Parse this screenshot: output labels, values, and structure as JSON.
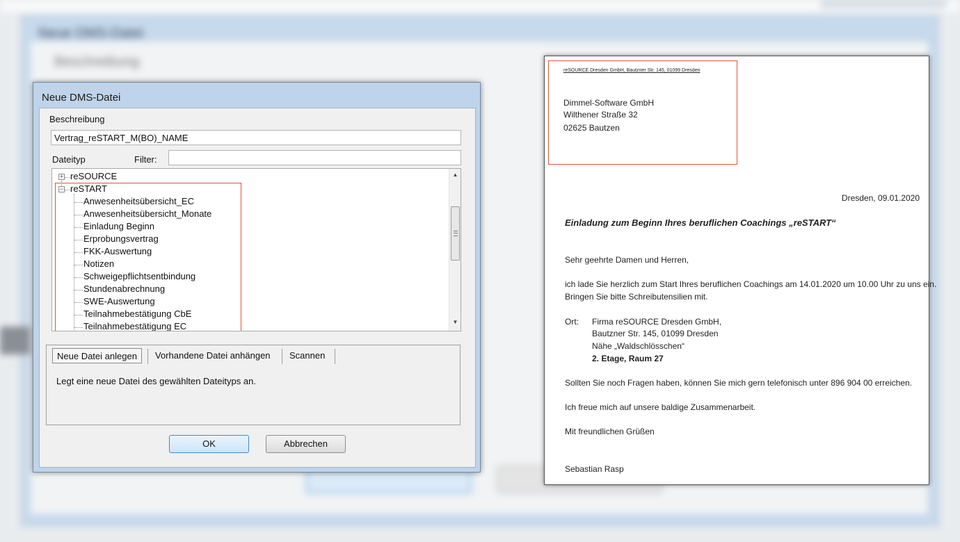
{
  "dialog": {
    "title": "Neue DMS-Datei",
    "beschreibung_label": "Beschreibung",
    "beschreibung_value": "Vertrag_reSTART_M(BO)_NAME",
    "dateityp_label": "Dateityp",
    "filter_label": "Filter:",
    "filter_value": "",
    "tree": {
      "root1": "reSOURCE",
      "root2": "reSTART",
      "children": [
        "Anwesenheitsübersicht_EC",
        "Anwesenheitsübersicht_Monate",
        "Einladung Beginn",
        "Erprobungsvertrag",
        "FKK-Auswertung",
        "Notizen",
        "Schweigepflichtsentbindung",
        "Stundenabrechnung",
        "SWE-Auswertung",
        "Teilnahmebestätigung CbE",
        "Teilnahmebestätigung EC"
      ]
    },
    "tabs": [
      "Neue Datei anlegen",
      "Vorhandene Datei anhängen",
      "Scannen"
    ],
    "tab_description": "Legt eine neue Datei des gewählten Dateityps an.",
    "ok_label": "OK",
    "cancel_label": "Abbrechen"
  },
  "letter": {
    "sender_line": "reSOURCE Dresden GmbH, Bautzner Str. 145, 01099 Dresden",
    "recipient": [
      "Dimmel-Software GmbH",
      "Wilthener Straße 32",
      "02625 Bautzen"
    ],
    "date_line": "Dresden, 09.01.2020",
    "subject": "Einladung zum Beginn Ihres beruflichen Coachings „reSTART“",
    "salutation": "Sehr geehrte Damen und Herren,",
    "body1_line1": "ich lade Sie herzlich zum Start Ihres beruflichen Coachings am 14.01.2020 um 10.00 Uhr zu uns ein.",
    "body1_line2": "Bringen Sie bitte Schreibutensilien mit.",
    "ort_label": "Ort:",
    "ort_lines": [
      "Firma reSOURCE Dresden GmbH,",
      "Bautzner Str. 145, 01099 Dresden",
      "Nähe „Waldschlösschen“",
      "2. Etage, Raum 27"
    ],
    "questions": "Sollten Sie noch Fragen haben, können Sie mich gern telefonisch unter 896 904 00 erreichen.",
    "closing1": "Ich freue mich auf unsere baldige Zusammenarbeit.",
    "closing2": "Mit freundlichen Grüßen",
    "signature": "Sebastian Rasp"
  },
  "background": {
    "window_title": "Neue DMS-Datei",
    "label": "Beschreibung"
  }
}
